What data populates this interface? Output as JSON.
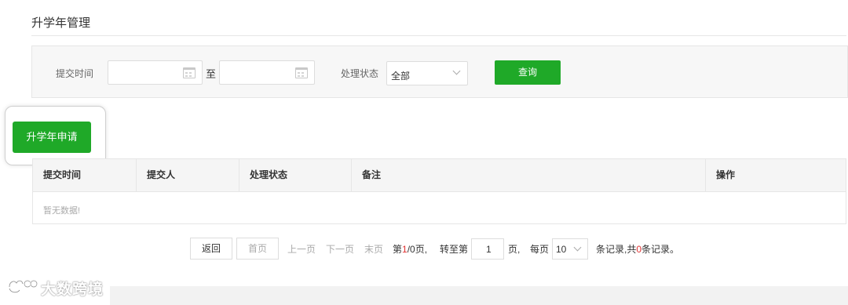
{
  "page": {
    "title": "升学年管理"
  },
  "filters": {
    "submit_time_label": "提交时间",
    "to_label": "至",
    "status_label": "处理状态",
    "status_value": "全部",
    "query_label": "查询"
  },
  "actions": {
    "apply_label": "升学年申请"
  },
  "table": {
    "headers": [
      "提交时间",
      "提交人",
      "处理状态",
      "备注",
      "操作"
    ],
    "empty_text": "暂无数据!"
  },
  "pagination": {
    "back": "返回",
    "first": "首页",
    "prev": "上一页",
    "next": "下一页",
    "last": "末页",
    "page_prefix": "第",
    "page_current": "1",
    "page_suffix": "/0页,",
    "goto_prefix": "转至第",
    "goto_value": "1",
    "goto_suffix": "页,",
    "per_page_prefix": "每页",
    "per_page_value": "10",
    "per_page_suffix": "条记录,",
    "total_prefix": "共",
    "total_count": "0",
    "total_suffix": "条记录。"
  },
  "watermark": {
    "text": "大数跨境",
    "icon": "brand-logo-icon"
  },
  "colors": {
    "primary_green": "#1fa928",
    "accent_red": "#e03030"
  }
}
